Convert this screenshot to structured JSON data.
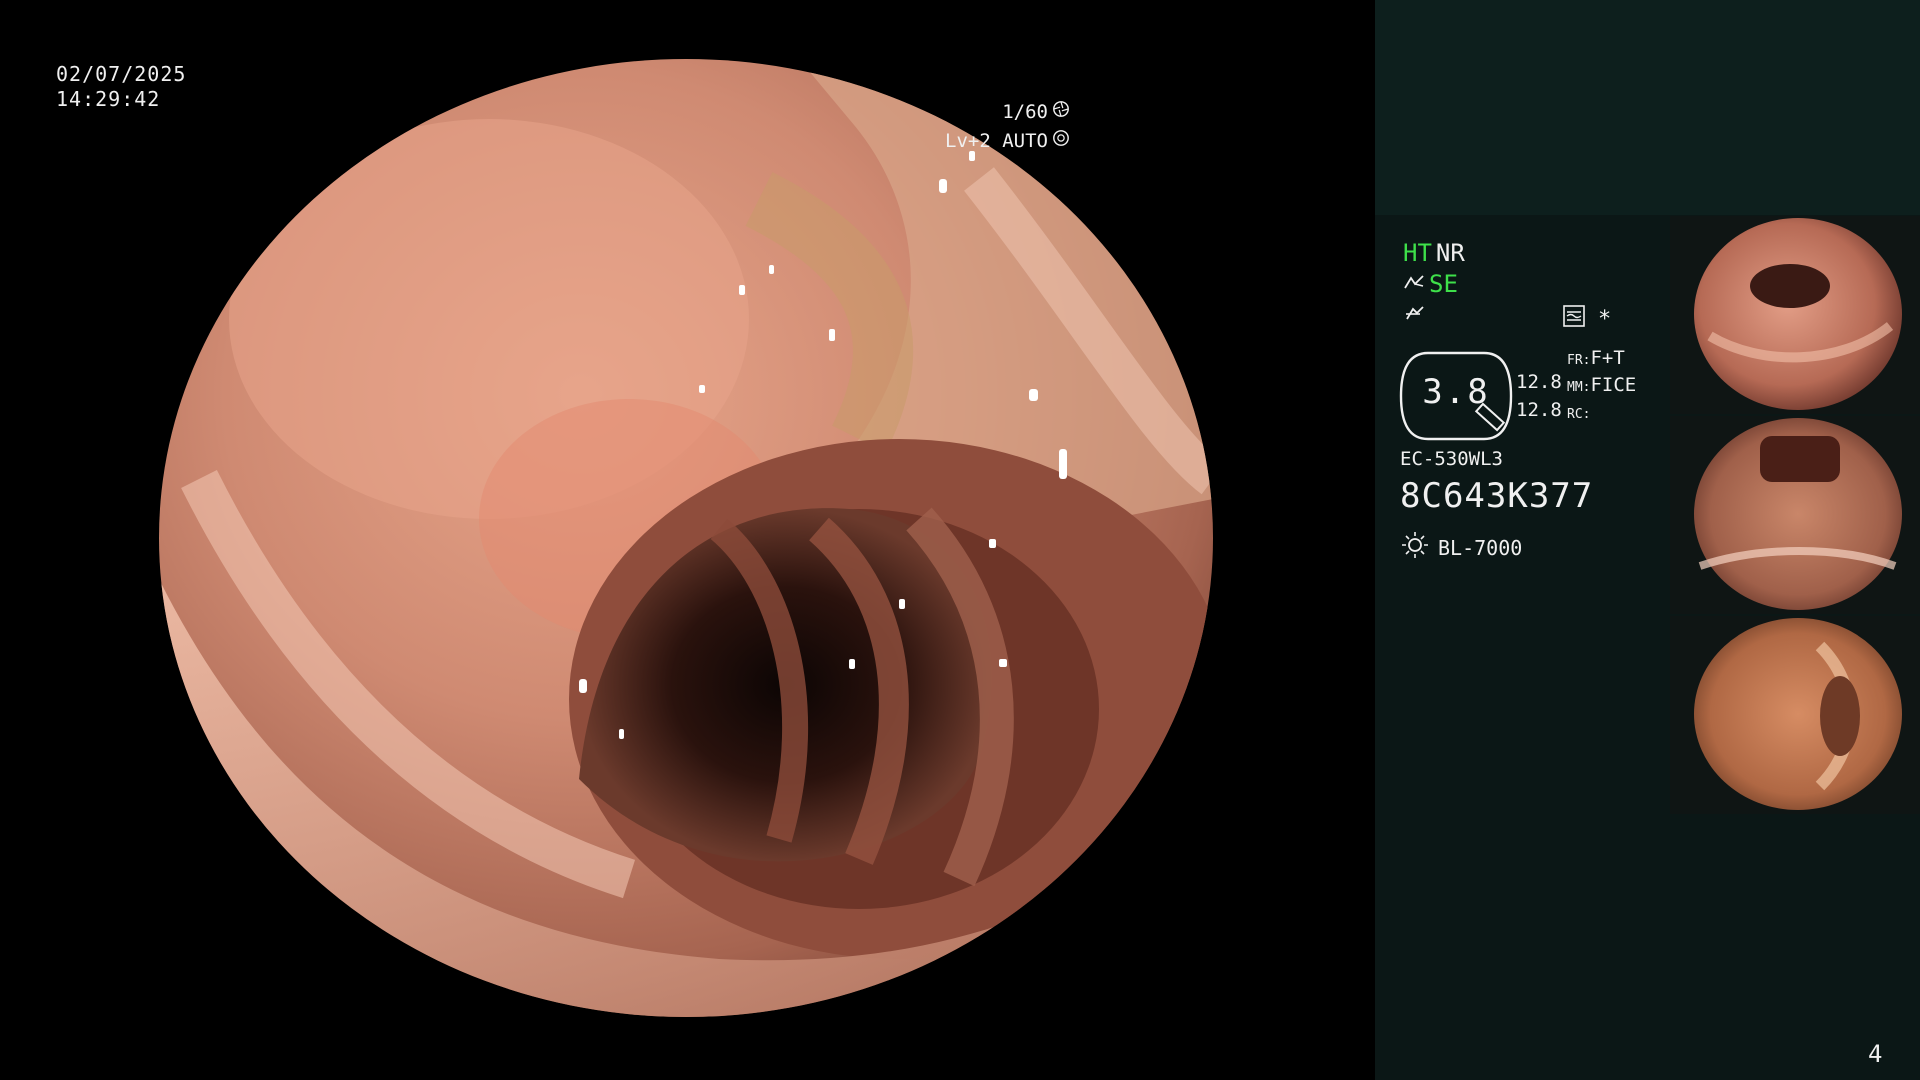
{
  "overlay": {
    "date": "02/07/2025",
    "time": "14:29:42",
    "shutter": "1/60",
    "shutter_icon": "aperture-icon",
    "level": "Lv+2 AUTO",
    "level_icon": "auto-iris-icon"
  },
  "panel": {
    "mode_ht": "HT",
    "mode_nr": "NR",
    "mode_se": "SE",
    "star_symbol": "*",
    "gauge_value": "3.8",
    "value_top": "12.8",
    "value_bottom": "12.8",
    "fr_key": "FR:",
    "fr_value": "F+T",
    "mm_key": "MM:",
    "mm_value": "FICE",
    "rc_key": "RC:",
    "rc_value": "",
    "scope_model": "EC-530WL3",
    "serial": "8C643K377",
    "light_source": "BL-7000"
  },
  "colors": {
    "accent_green": "#3ee04a",
    "panel_bg": "#0b1716",
    "panel_top_bg": "#0d1f1d"
  },
  "page_number": "4"
}
